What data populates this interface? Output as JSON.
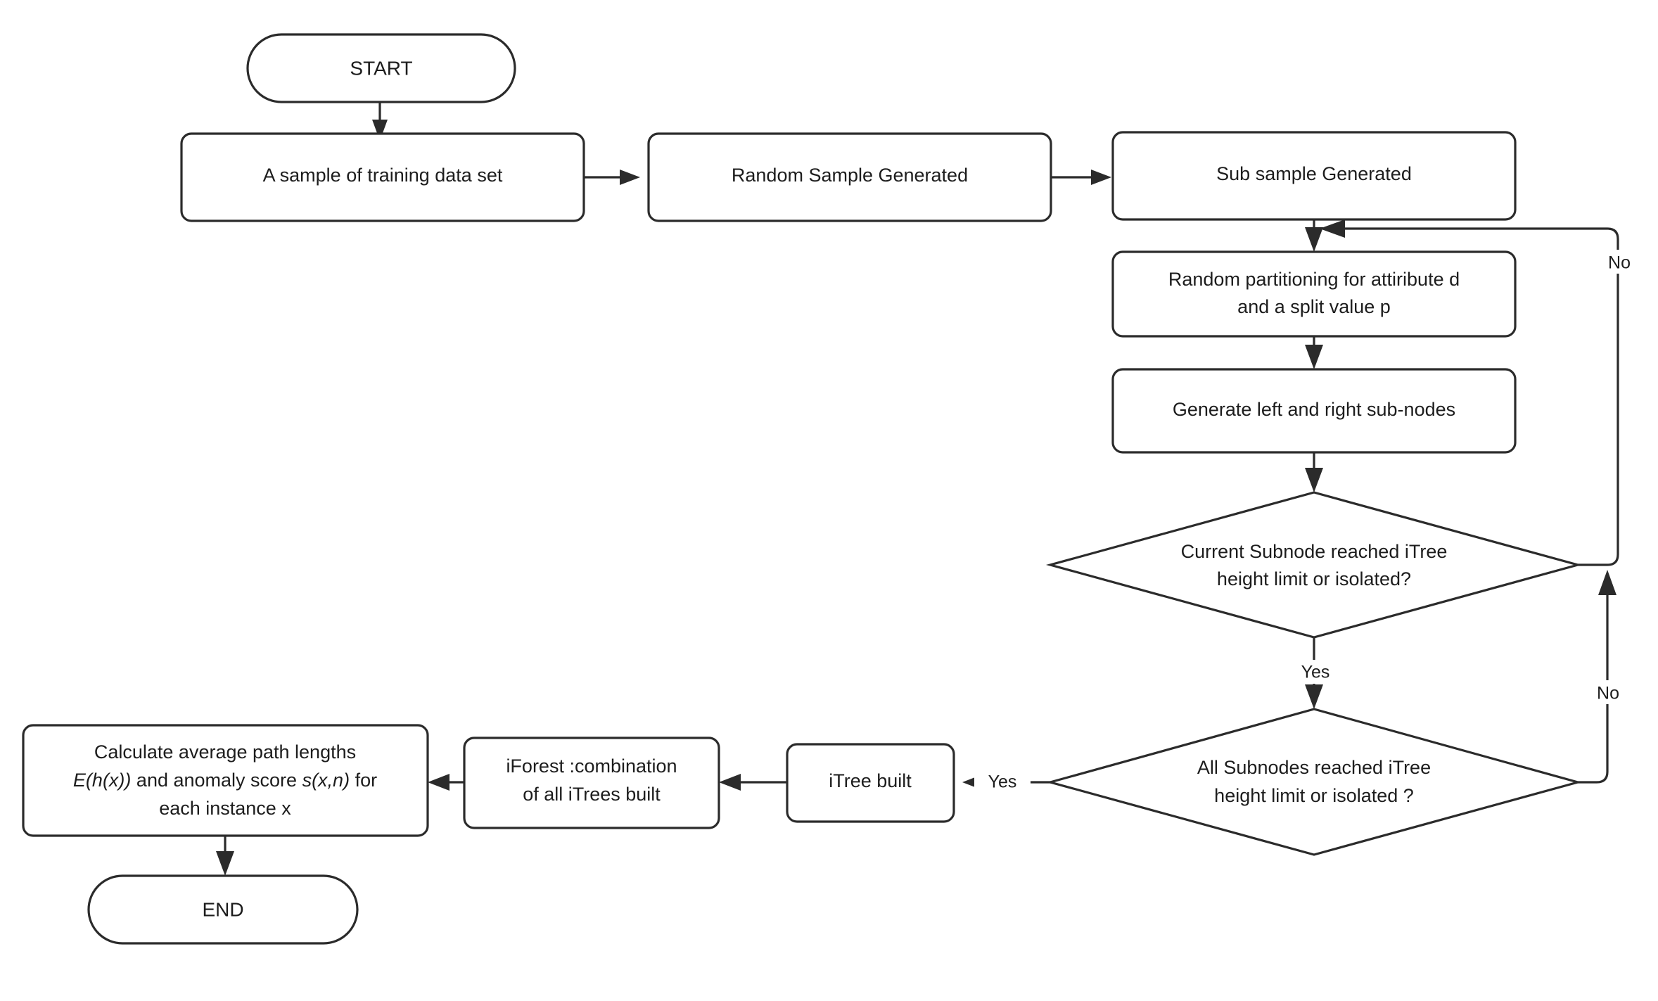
{
  "diagram": {
    "type": "flowchart",
    "title": "Isolation Forest (iForest) training flowchart",
    "orientation": "mixed",
    "background_color": "#ffffff",
    "stroke_color": "#2b2b2b",
    "text_color": "#1d1d1d",
    "nodes": {
      "start": {
        "label": "START",
        "shape": "terminator"
      },
      "training_sample": {
        "label": "A sample of training data set",
        "shape": "process"
      },
      "random_sample": {
        "label": "Random Sample Generated",
        "shape": "process"
      },
      "sub_sample": {
        "label": "Sub sample Generated",
        "shape": "process"
      },
      "random_partition_line1": "Random partitioning for attiribute d",
      "random_partition_line2": "and a split value p",
      "generate_subnodes": {
        "label": "Generate left and right sub-nodes",
        "shape": "process"
      },
      "decision1_line1": "Current Subnode reached iTree",
      "decision1_line2": "height limit or isolated?",
      "decision2_line1": "All Subnodes reached iTree",
      "decision2_line2": "height limit or isolated ?",
      "itree_built": {
        "label": "iTree built",
        "shape": "process"
      },
      "iforest_line1": "iForest :combination",
      "iforest_line2": "of all iTrees built",
      "calculate_line1": "Calculate average path lengths",
      "calculate_line2a": "E(h(x))",
      "calculate_line2b": " and anomaly score ",
      "calculate_line2c": "s(x,n)",
      "calculate_line2d": " for",
      "calculate_line3": "each instance x",
      "end": {
        "label": "END",
        "shape": "terminator"
      }
    },
    "edge_labels": {
      "decision1_no": "No",
      "decision1_yes": "Yes",
      "decision2_no": "No",
      "decision2_yes": "Yes"
    }
  }
}
